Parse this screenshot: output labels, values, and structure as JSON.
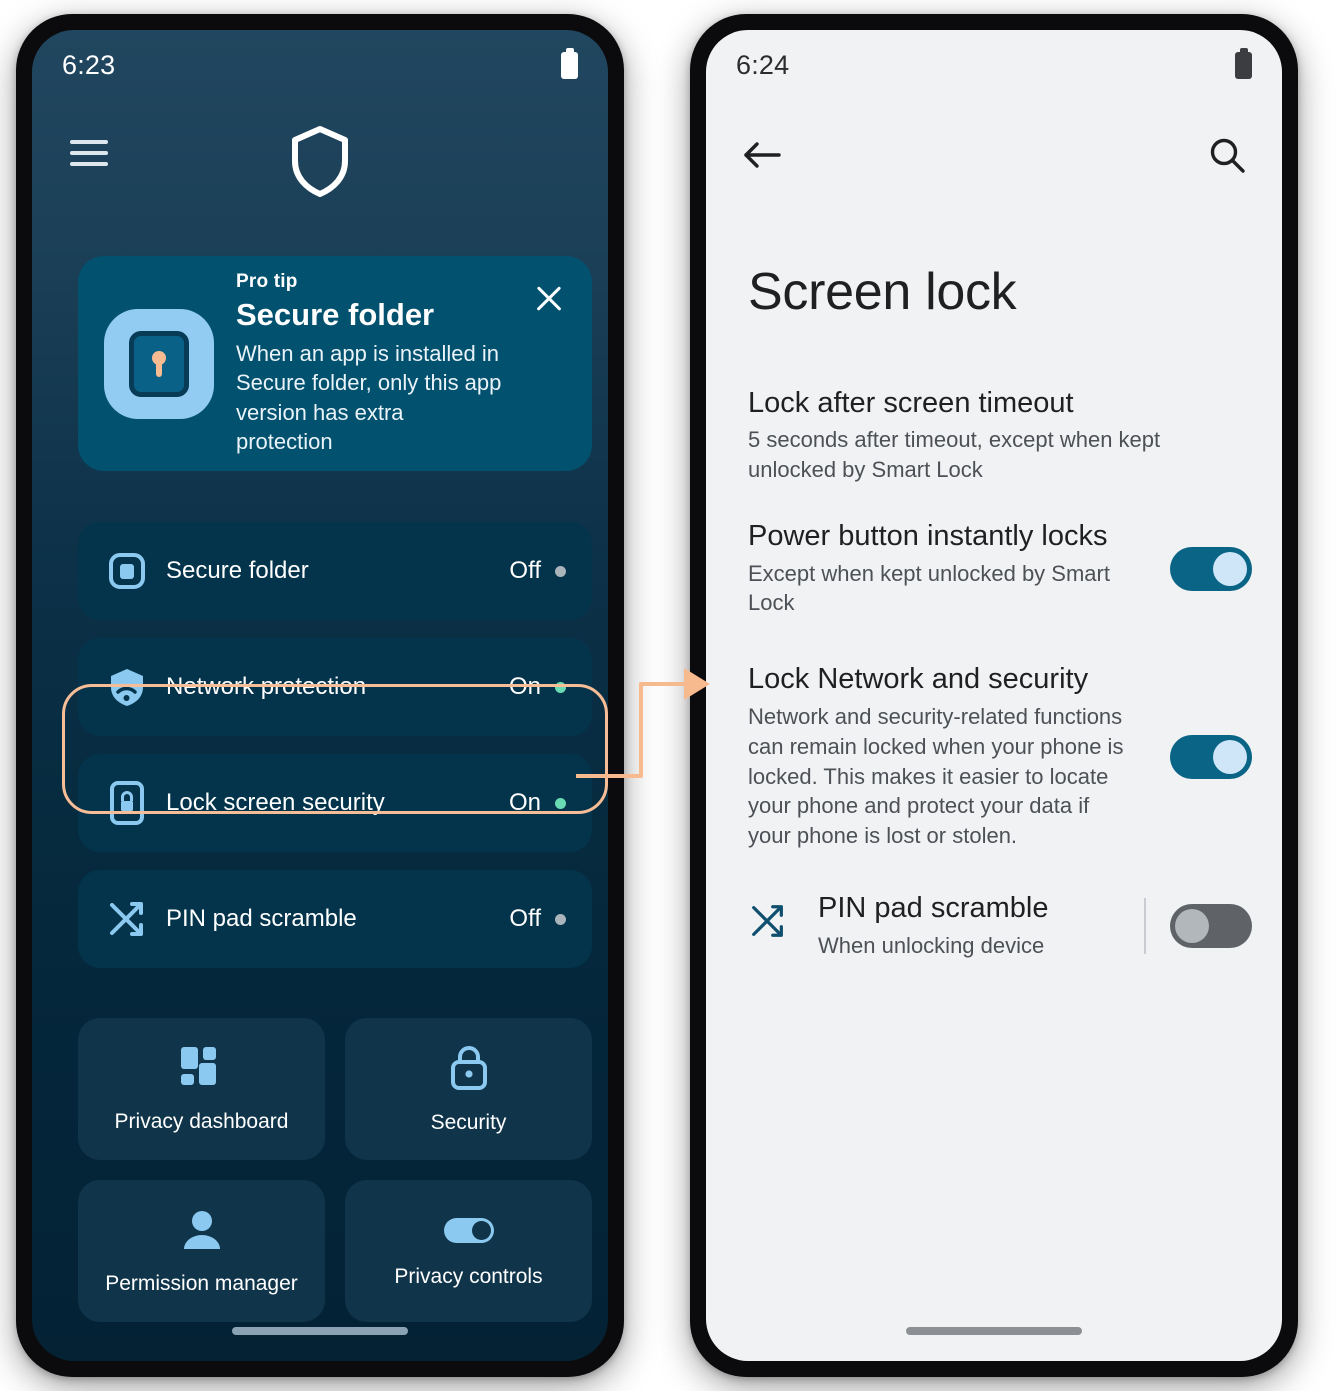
{
  "left_phone": {
    "status": {
      "time": "6:23",
      "battery_icon": "battery-icon"
    },
    "appbar": {
      "menu_icon": "hamburger-menu-icon",
      "logo_icon": "shield-logo-icon"
    },
    "tip_card": {
      "kicker": "Pro tip",
      "title": "Secure folder",
      "body": "When an app is installed in Secure folder, only this app version has extra protection",
      "icon": "secure-folder-lock-icon",
      "close_icon": "close-icon"
    },
    "rows": [
      {
        "icon": "secure-folder-icon",
        "label": "Secure folder",
        "state": "Off",
        "state_on": false
      },
      {
        "icon": "network-shield-icon",
        "label": "Network protection",
        "state": "On",
        "state_on": true
      },
      {
        "icon": "phone-lock-icon",
        "label": "Lock screen security",
        "state": "On",
        "state_on": true
      },
      {
        "icon": "shuffle-icon",
        "label": "PIN pad scramble",
        "state": "Off",
        "state_on": false
      }
    ],
    "tiles": [
      {
        "icon": "dashboard-grid-icon",
        "label": "Privacy dashboard"
      },
      {
        "icon": "padlock-icon",
        "label": "Security"
      },
      {
        "icon": "person-icon",
        "label": "Permission manager"
      },
      {
        "icon": "toggle-icon",
        "label": "Privacy controls"
      }
    ]
  },
  "right_phone": {
    "status": {
      "time": "6:24",
      "battery_icon": "battery-icon"
    },
    "appbar": {
      "back_icon": "back-arrow-icon",
      "search_icon": "search-icon"
    },
    "title": "Screen lock",
    "settings": [
      {
        "title": "Lock after screen timeout",
        "subtitle": "5 seconds after timeout, except when kept unlocked by Smart Lock",
        "toggle": null
      },
      {
        "title": "Power button instantly locks",
        "subtitle": "Except when kept unlocked by Smart Lock",
        "toggle": "on"
      },
      {
        "title": "Lock Network and security",
        "subtitle": "Network and security-related functions can remain locked when your phone is locked. This makes it easier to locate your phone and protect your data if your phone is lost or stolen.",
        "toggle": "on"
      },
      {
        "title": "PIN pad scramble",
        "subtitle": "When unlocking device",
        "toggle": "off",
        "icon": "shuffle-icon"
      }
    ]
  },
  "annotation": {
    "highlight_target": "Lock screen security",
    "highlight_color": "#f6bd96",
    "arrow_color": "#f7b98e"
  },
  "colors": {
    "dark_bg_top": "#21465f",
    "dark_bg_bottom": "#042234",
    "card_bg": "#02516f",
    "row_bg": "#03344b",
    "tile_bg": "#10344a",
    "accent_icon": "#8cc9f0",
    "status_on": "#69dbb4",
    "status_off": "#a9b4bb",
    "light_bg": "#f1f2f4",
    "toggle_on": "#0a6486",
    "toggle_off": "#5f6368"
  }
}
